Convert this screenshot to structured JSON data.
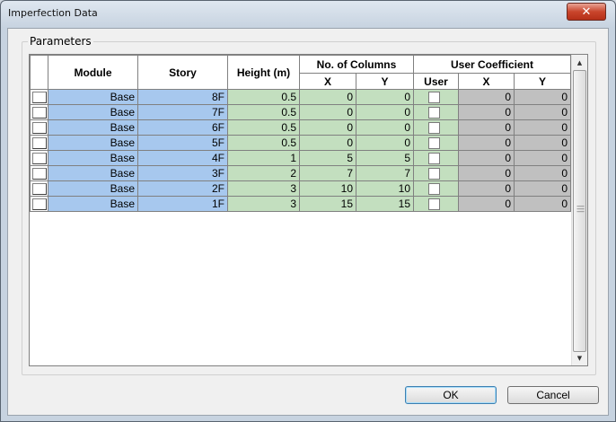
{
  "window": {
    "title": "Imperfection Data",
    "close_glyph": "✕"
  },
  "group": {
    "label": "Parameters"
  },
  "headers": {
    "module": "Module",
    "story": "Story",
    "height": "Height (m)",
    "no_columns": "No. of Columns",
    "col_x": "X",
    "col_y": "Y",
    "user_coeff": "User Coefficient",
    "user": "User",
    "coeff_x": "X",
    "coeff_y": "Y"
  },
  "rows": [
    {
      "module": "Base",
      "story": "8F",
      "height": "0.5",
      "cx": "0",
      "cy": "0",
      "user": false,
      "ux": "0",
      "uy": "0"
    },
    {
      "module": "Base",
      "story": "7F",
      "height": "0.5",
      "cx": "0",
      "cy": "0",
      "user": false,
      "ux": "0",
      "uy": "0"
    },
    {
      "module": "Base",
      "story": "6F",
      "height": "0.5",
      "cx": "0",
      "cy": "0",
      "user": false,
      "ux": "0",
      "uy": "0"
    },
    {
      "module": "Base",
      "story": "5F",
      "height": "0.5",
      "cx": "0",
      "cy": "0",
      "user": false,
      "ux": "0",
      "uy": "0"
    },
    {
      "module": "Base",
      "story": "4F",
      "height": "1",
      "cx": "5",
      "cy": "5",
      "user": false,
      "ux": "0",
      "uy": "0"
    },
    {
      "module": "Base",
      "story": "3F",
      "height": "2",
      "cx": "7",
      "cy": "7",
      "user": false,
      "ux": "0",
      "uy": "0"
    },
    {
      "module": "Base",
      "story": "2F",
      "height": "3",
      "cx": "10",
      "cy": "10",
      "user": false,
      "ux": "0",
      "uy": "0"
    },
    {
      "module": "Base",
      "story": "1F",
      "height": "3",
      "cx": "15",
      "cy": "15",
      "user": false,
      "ux": "0",
      "uy": "0"
    }
  ],
  "buttons": {
    "ok": "OK",
    "cancel": "Cancel"
  },
  "colors": {
    "module_story": "#a7c8ee",
    "editable": "#c3dfbf",
    "disabled": "#c0c0c0"
  },
  "icons": {
    "scroll_up": "scroll-up-arrow-icon",
    "scroll_down": "scroll-down-arrow-icon"
  }
}
